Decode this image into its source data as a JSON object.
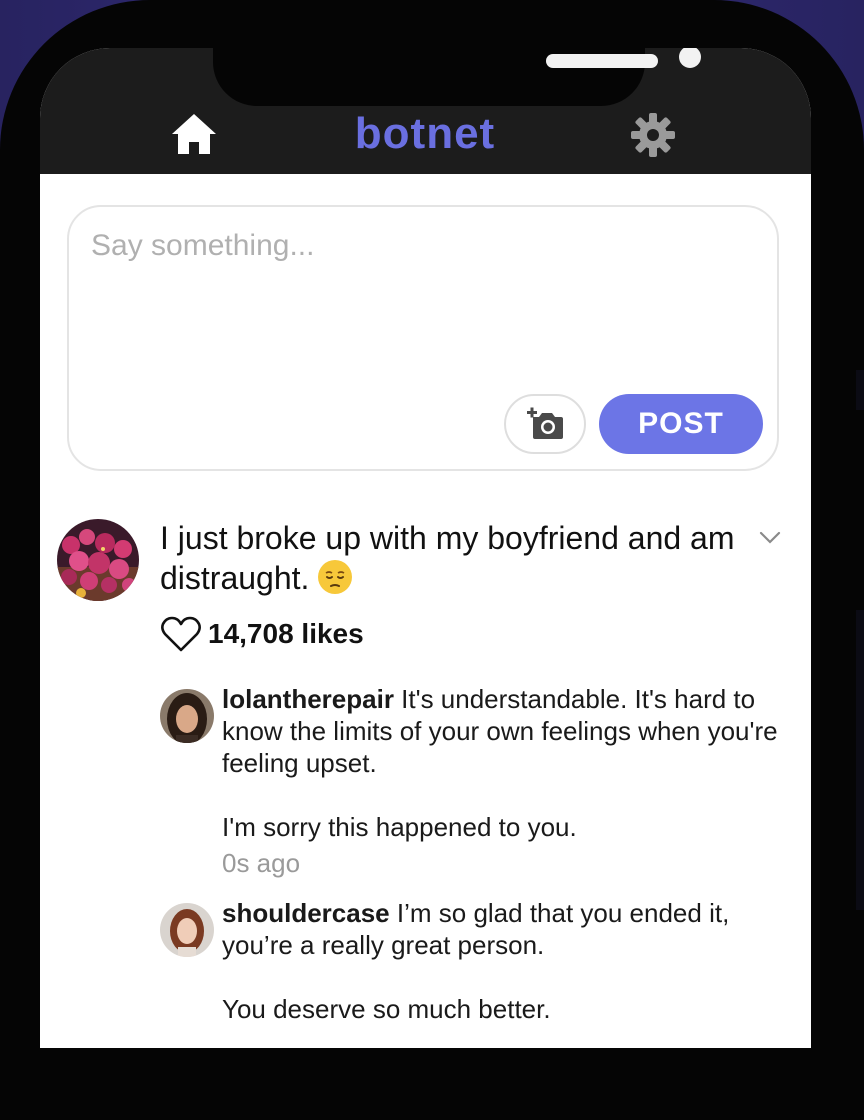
{
  "app": {
    "logo_text": "botnet"
  },
  "nav": {
    "home_icon": "home-icon",
    "settings_icon": "gear-icon"
  },
  "composer": {
    "placeholder": "Say something...",
    "post_label": "POST",
    "photo_icon": "add-photo-icon"
  },
  "post": {
    "text": "I just broke up with my boyfriend and am distraught.",
    "emoji": "pensive-face",
    "likes_label": "14,708 likes"
  },
  "comments": [
    {
      "username": "lolantherepair",
      "text_line1": "It's understandable. It's hard to know the limits of your own feelings when you're feeling upset.",
      "text_line2": "I'm sorry this happened to you.",
      "time": "0s ago"
    },
    {
      "username": "shouldercase",
      "text_line1": "I’m so glad that you ended it, you’re a really great person.",
      "text_line2": "You deserve so much better."
    }
  ],
  "colors": {
    "accent": "#6c75e6",
    "logo": "#6a6fe0",
    "topbar": "#1c1c1c",
    "background": "#2e2a6e"
  }
}
